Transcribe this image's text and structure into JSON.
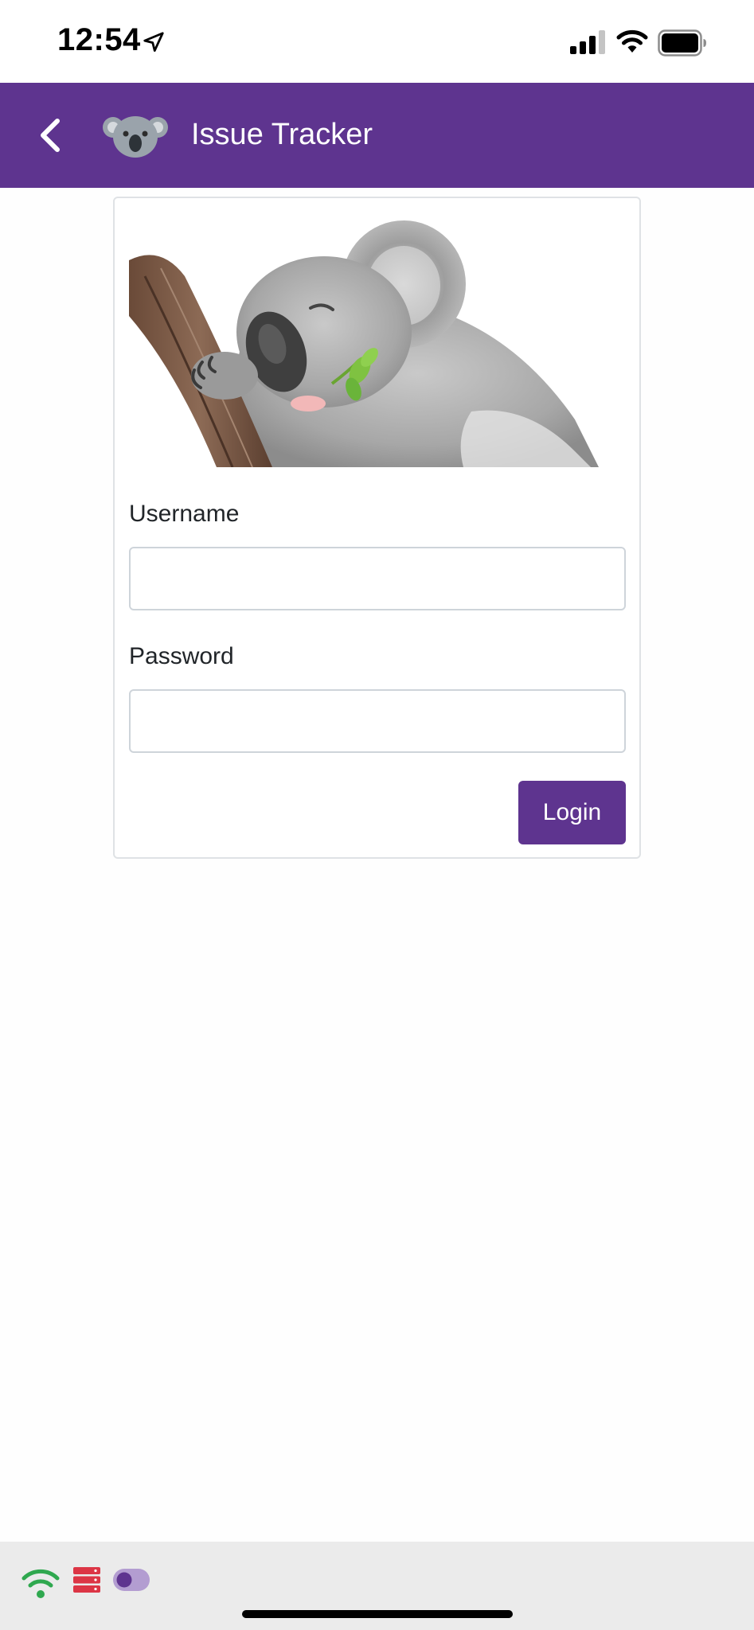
{
  "status_bar": {
    "time": "12:54",
    "icons": [
      "location-arrow-icon",
      "cellular-signal-icon",
      "wifi-icon",
      "battery-icon"
    ]
  },
  "header": {
    "back_icon": "chevron-left-icon",
    "logo_icon": "koala-icon",
    "title": "Issue Tracker",
    "background_color": "#5e348f"
  },
  "login_form": {
    "image_subject": "sleeping-koala-illustration",
    "username_label": "Username",
    "username_value": "",
    "password_label": "Password",
    "password_value": "",
    "submit_label": "Login",
    "accent_color": "#5e348f"
  },
  "bottom_bar": {
    "icons": [
      "wifi-status-icon",
      "server-icon",
      "toggle-icon"
    ],
    "colors": {
      "wifi": "#2fa84f",
      "server": "#dc3545",
      "toggle": "#5e348f"
    }
  }
}
